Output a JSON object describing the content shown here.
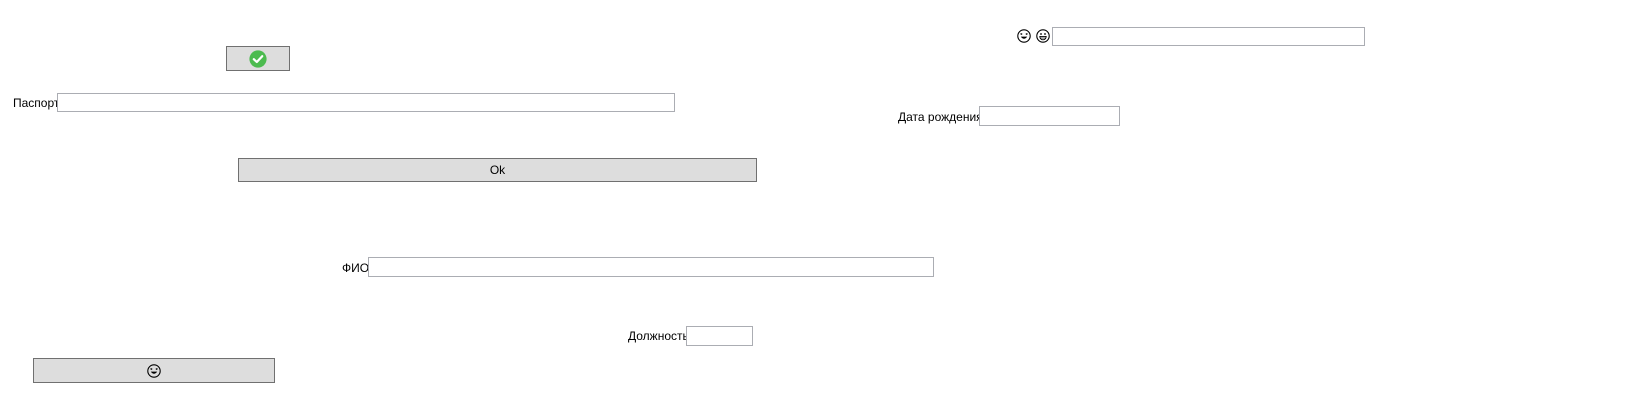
{
  "form": {
    "passport_label": "Паспорт",
    "passport_value": "",
    "birthdate_label": "Дата рождения",
    "birthdate_value": "",
    "fio_label": "ФИО",
    "fio_value": "",
    "position_label": "Должность",
    "position_value": "",
    "top_field_value": "",
    "ok_label": "Ok"
  },
  "icons": {
    "check_button_icon": "check-circle-icon",
    "top_emoji_1": "laughing-face-icon",
    "top_emoji_2": "grinning-face-icon",
    "bottom_button_icon": "laughing-face-icon",
    "check_color": "#4cbb4f"
  }
}
